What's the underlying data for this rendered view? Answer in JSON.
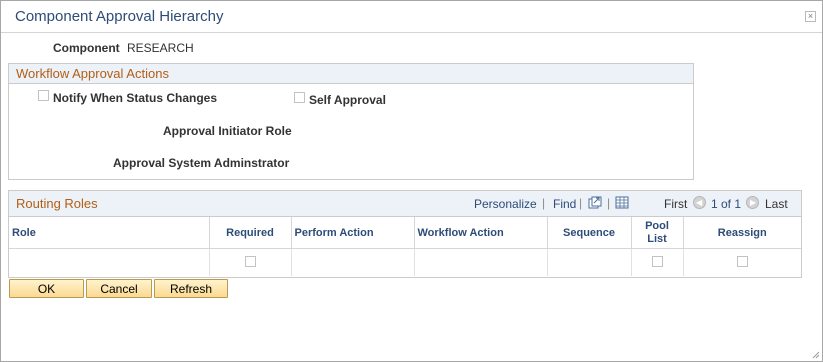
{
  "dialog": {
    "title": "Component Approval Hierarchy",
    "close_symbol": "×"
  },
  "component": {
    "label": "Component",
    "value": "RESEARCH"
  },
  "workflow": {
    "title": "Workflow Approval Actions",
    "notify_label": "Notify When Status Changes",
    "notify_checked": false,
    "self_approval_label": "Self Approval",
    "self_approval_checked": false,
    "initiator_role_label": "Approval Initiator Role",
    "initiator_role_value": "",
    "system_admin_label": "Approval System Adminstrator",
    "system_admin_value": ""
  },
  "routing": {
    "title": "Routing Roles",
    "personalize": "Personalize",
    "separator": "|",
    "find": "Find",
    "first": "First",
    "range": "1 of 1",
    "last": "Last",
    "columns": {
      "role": "Role",
      "required": "Required",
      "perform_action": "Perform Action",
      "workflow_action": "Workflow Action",
      "sequence": "Sequence",
      "pool_list": "Pool List",
      "reassign": "Reassign"
    },
    "rows": [
      {
        "role": "",
        "required": false,
        "perform_action": "",
        "workflow_action": "",
        "sequence": "",
        "pool_list": false,
        "reassign": false
      }
    ]
  },
  "buttons": {
    "ok": "OK",
    "cancel": "Cancel",
    "refresh": "Refresh"
  },
  "colors": {
    "title_blue": "#2d4c77",
    "group_orange": "#b35e15",
    "header_bg": "#edf2f8",
    "button_gold": "#fbd991"
  }
}
